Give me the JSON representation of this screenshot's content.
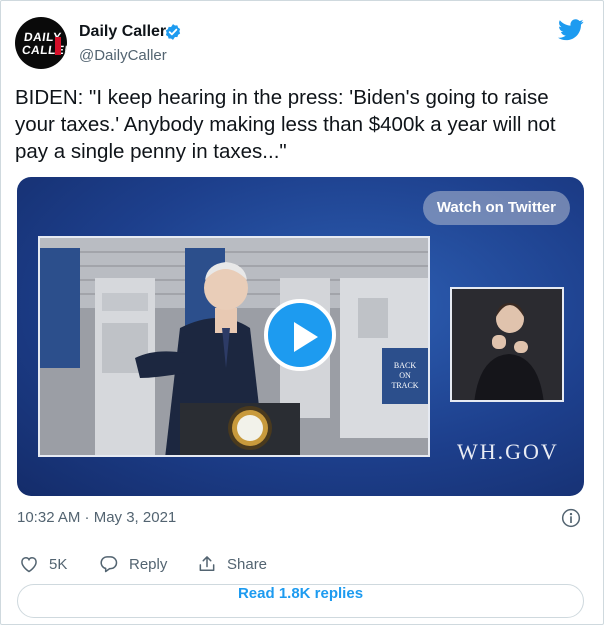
{
  "author": {
    "avatar_text_line1": "DAILY",
    "avatar_text_line2": "CALLER",
    "display_name": "Daily Caller",
    "handle": "@DailyCaller",
    "verified": true
  },
  "tweet": {
    "text": "BIDEN: \"I keep hearing in the press: 'Biden's going to raise your taxes.' Anybody making less than $400k a year will not pay a single penny in taxes...\"",
    "timestamp": "10:32 AM · May 3, 2021"
  },
  "media": {
    "watch_label": "Watch on Twitter",
    "watermark": "WH.GOV",
    "podium_sign_line1": "BACK",
    "podium_sign_line2": "ON",
    "podium_sign_line3": "TRACK"
  },
  "actions": {
    "likes": "5K",
    "reply_label": "Reply",
    "share_label": "Share"
  },
  "read_replies_label": "Read 1.8K replies",
  "colors": {
    "accent": "#1d9bf0",
    "secondary_text": "#536471",
    "media_bg": "#1d3f8c",
    "brand_red": "#d6102a"
  },
  "icons": [
    "twitter-bird-icon",
    "verified-badge-icon",
    "play-icon",
    "info-icon",
    "heart-icon",
    "reply-icon",
    "share-icon"
  ]
}
